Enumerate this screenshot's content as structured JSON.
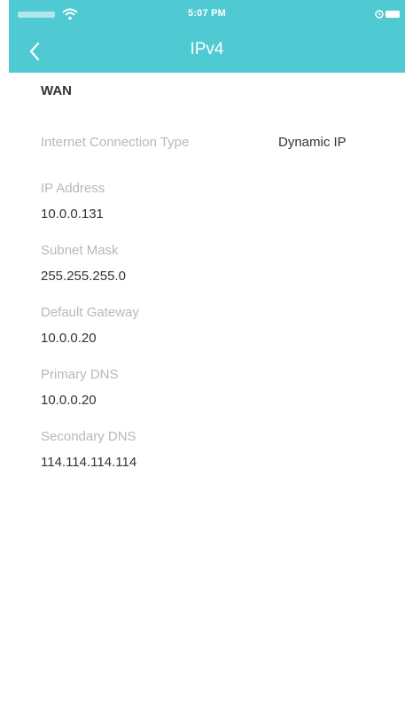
{
  "status_bar": {
    "time": "5:07 PM",
    "icons": [
      "signal-icon",
      "wifi-icon",
      "alarm-icon",
      "battery-icon"
    ]
  },
  "nav": {
    "title": "IPv4",
    "back_icon": "chevron-left-icon"
  },
  "colors": {
    "header_bg": "#4fc9d2",
    "label": "#b8b8b8",
    "value": "#333333"
  },
  "wan": {
    "section_title": "WAN",
    "connection_type": {
      "label": "Internet Connection Type",
      "value": "Dynamic IP"
    },
    "fields": [
      {
        "label": "IP Address",
        "value": "10.0.0.131"
      },
      {
        "label": "Subnet Mask",
        "value": "255.255.255.0"
      },
      {
        "label": "Default Gateway",
        "value": "10.0.0.20"
      },
      {
        "label": "Primary DNS",
        "value": "10.0.0.20"
      },
      {
        "label": "Secondary DNS",
        "value": "114.114.114.114"
      }
    ]
  }
}
